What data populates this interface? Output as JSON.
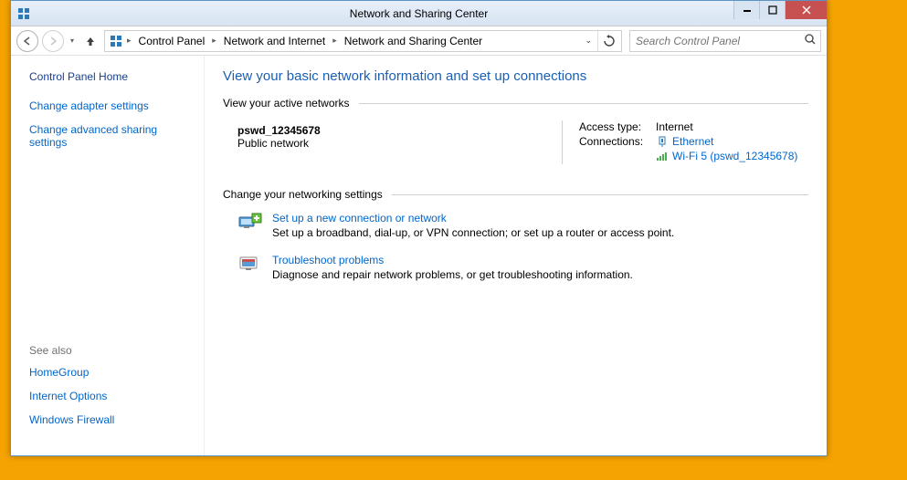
{
  "window": {
    "title": "Network and Sharing Center"
  },
  "breadcrumb": {
    "seg1": "Control Panel",
    "seg2": "Network and Internet",
    "seg3": "Network and Sharing Center"
  },
  "search": {
    "placeholder": "Search Control Panel"
  },
  "sidebar": {
    "home": "Control Panel Home",
    "adapter": "Change adapter settings",
    "advanced": "Change advanced sharing settings",
    "see_also_title": "See also",
    "homegroup": "HomeGroup",
    "inet_options": "Internet Options",
    "firewall": "Windows Firewall"
  },
  "main": {
    "title": "View your basic network information and set up connections",
    "active_header": "View your active networks",
    "network_name": "pswd_12345678",
    "network_type": "Public network",
    "access_label": "Access type:",
    "access_value": "Internet",
    "conn_label": "Connections:",
    "conn_eth": "Ethernet",
    "conn_wifi": "Wi-Fi 5 (pswd_12345678)",
    "change_header": "Change your networking settings",
    "task1_title": "Set up a new connection or network",
    "task1_desc": "Set up a broadband, dial-up, or VPN connection; or set up a router or access point.",
    "task2_title": "Troubleshoot problems",
    "task2_desc": "Diagnose and repair network problems, or get troubleshooting information."
  }
}
